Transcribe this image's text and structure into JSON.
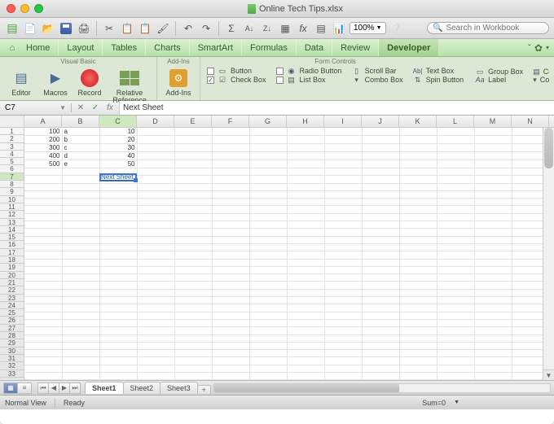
{
  "window_title": "Online Tech Tips.xlsx",
  "zoom": "100%",
  "search_placeholder": "Search in Workbook",
  "ribbon_tabs": [
    "Home",
    "Layout",
    "Tables",
    "Charts",
    "SmartArt",
    "Formulas",
    "Data",
    "Review",
    "Developer"
  ],
  "active_tab": "Developer",
  "groups": {
    "vb_title": "Visual Basic",
    "addins_title": "Add-Ins",
    "form_title": "Form Controls",
    "editor": "Editor",
    "macros": "Macros",
    "record": "Record",
    "relref": "Relative Reference",
    "addins": "Add-Ins"
  },
  "form_controls": {
    "button": "Button",
    "checkbox": "Check Box",
    "radio": "Radio Button",
    "listbox": "List Box",
    "scrollbar": "Scroll Bar",
    "combobox": "Combo Box",
    "textbox": "Text Box",
    "spin": "Spin Button",
    "groupbox": "Group Box",
    "label": "Label",
    "combo_list_e": "Combo List E",
    "combo_drop": "Combo Drop"
  },
  "namebox": "C7",
  "formula": "Next Sheet",
  "columns": [
    "A",
    "B",
    "C",
    "D",
    "E",
    "F",
    "G",
    "H",
    "I",
    "J",
    "K",
    "L",
    "M",
    "N"
  ],
  "rows_count": 33,
  "data_rows": [
    {
      "a": "100",
      "b": "a",
      "c": "10"
    },
    {
      "a": "200",
      "b": "b",
      "c": "20"
    },
    {
      "a": "300",
      "b": "c",
      "c": "30"
    },
    {
      "a": "400",
      "b": "d",
      "c": "40"
    },
    {
      "a": "500",
      "b": "e",
      "c": "50"
    }
  ],
  "sel_cell_text": "Next Sheet",
  "sheets": [
    "Sheet1",
    "Sheet2",
    "Sheet3"
  ],
  "active_sheet": "Sheet1",
  "status": {
    "view": "Normal View",
    "ready": "Ready",
    "sum": "Sum=0"
  }
}
